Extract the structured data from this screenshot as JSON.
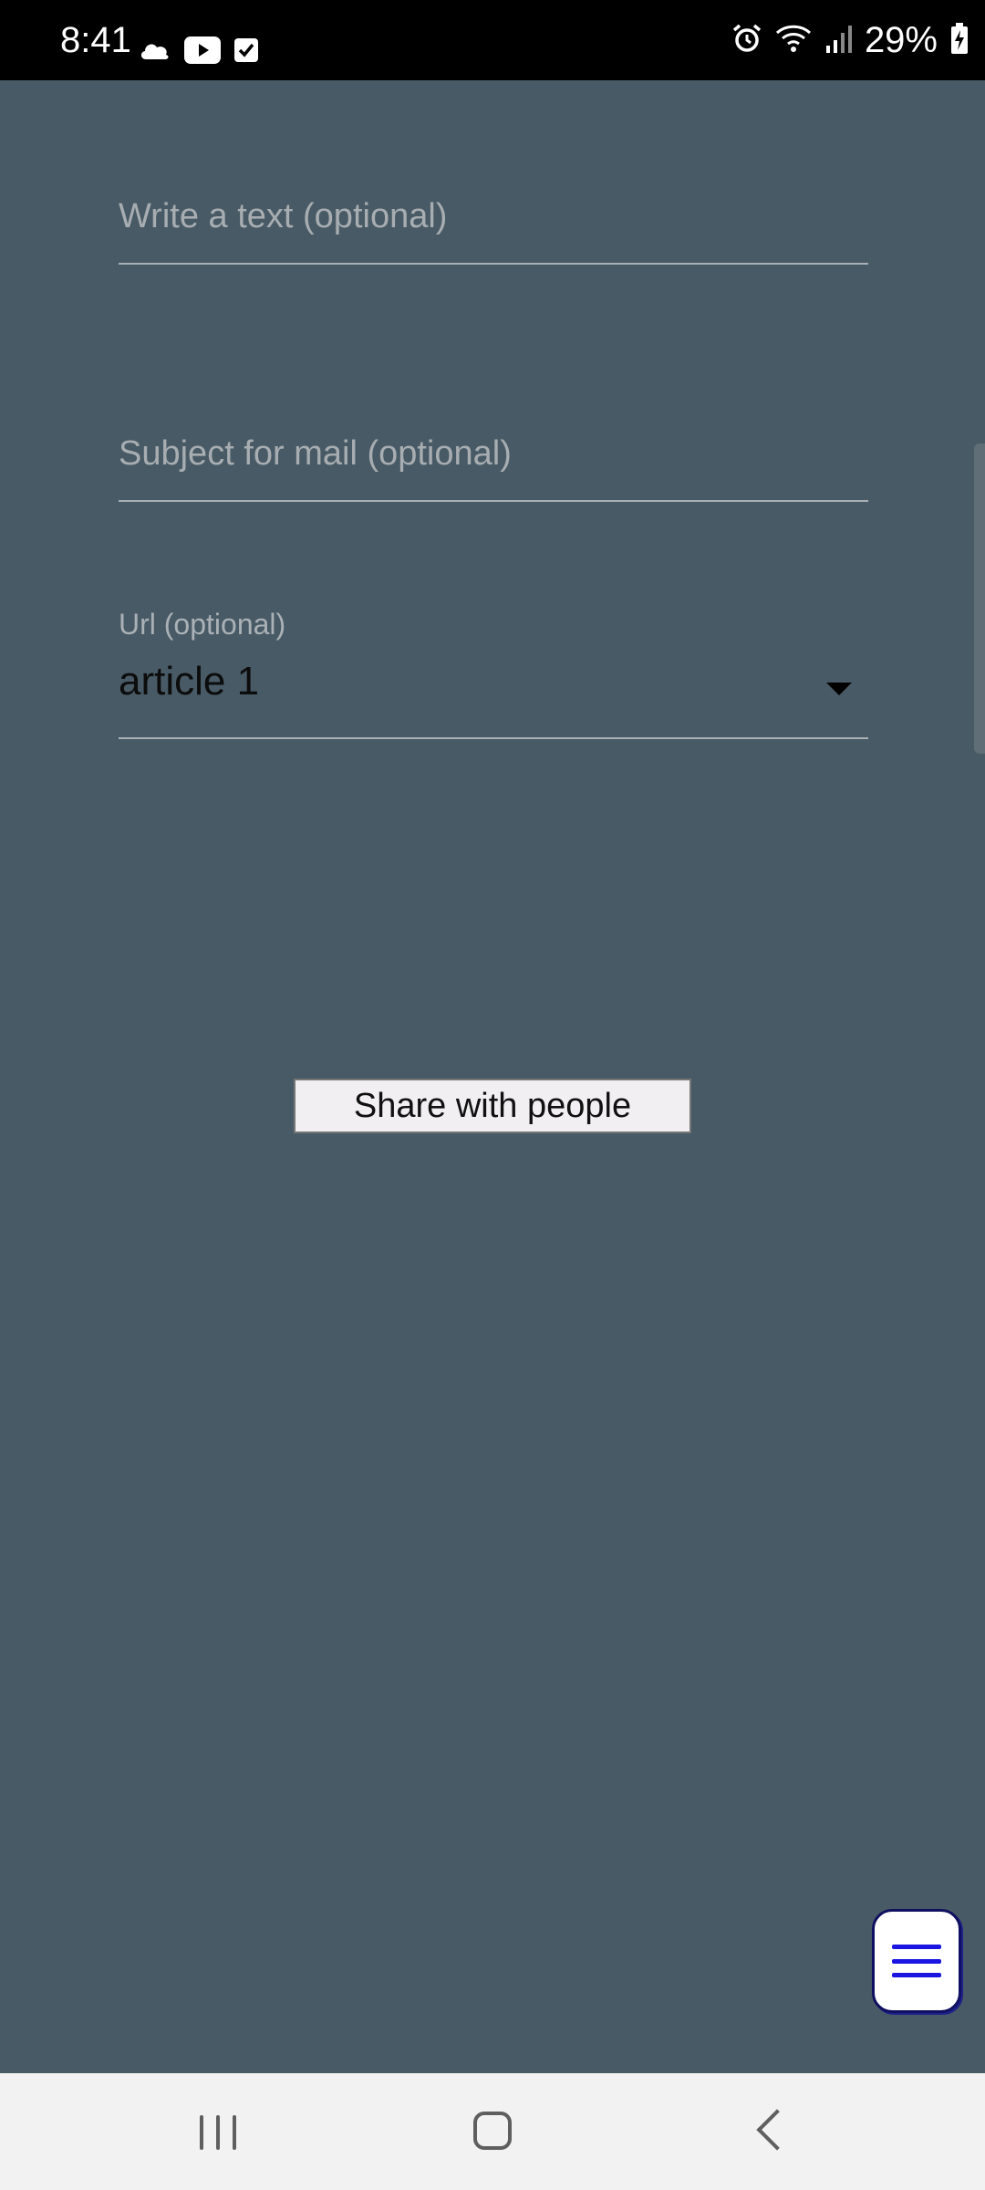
{
  "status_bar": {
    "time": "8:41",
    "battery_percent": "29%",
    "left_icons": [
      "cloud-icon",
      "youtube-icon",
      "checkbox-icon"
    ],
    "right_icons": [
      "alarm-icon",
      "wifi-icon",
      "signal-icon",
      "battery-charging-icon"
    ]
  },
  "form": {
    "text_placeholder": "Write a text (optional)",
    "subject_placeholder": "Subject for mail (optional)",
    "url_label": "Url (optional)",
    "url_value": "article 1"
  },
  "share_button": {
    "label": "Share with people"
  },
  "fab": {
    "icon": "menu-icon"
  },
  "nav_bar": {
    "icons": [
      "recent-apps-icon",
      "home-icon",
      "back-icon"
    ]
  },
  "colors": {
    "background": "#485a65",
    "fab_accent": "#1a15e0"
  }
}
